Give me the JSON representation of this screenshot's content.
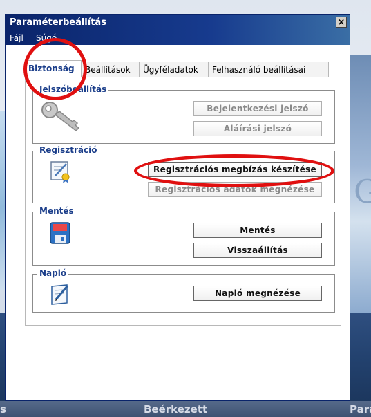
{
  "background": {
    "bottom_nav": {
      "left": "s",
      "middle": "Beérkezett",
      "right": "Para"
    }
  },
  "window": {
    "title": "Paraméterbeállítás",
    "close_glyph": "×",
    "menu": {
      "file": "Fájl",
      "help": "Súgó"
    },
    "tabs": [
      {
        "label": "Biztonság",
        "active": true
      },
      {
        "label": "Beállítások",
        "active": false
      },
      {
        "label": "Ügyféladatok",
        "active": false
      },
      {
        "label": "Felhasználó beállításai",
        "active": false
      }
    ],
    "groups": {
      "password": {
        "title": "Jelszóbeállítás",
        "icon": "key-icon",
        "buttons": {
          "login": "Bejelentkezési jelszó",
          "signing": "Aláírási jelszó"
        }
      },
      "registration": {
        "title": "Regisztráció",
        "icon": "certificate-icon",
        "buttons": {
          "create": "Regisztrációs megbízás készítése",
          "view": "Regisztrációs adatok megnézése"
        }
      },
      "save": {
        "title": "Mentés",
        "icon": "floppy-disk-icon",
        "buttons": {
          "save": "Mentés",
          "restore": "Visszaállítás"
        }
      },
      "log": {
        "title": "Napló",
        "icon": "notebook-pen-icon",
        "buttons": {
          "view": "Napló megnézése"
        }
      }
    }
  },
  "colors": {
    "titlebar": "#0a246a",
    "group_title": "#1b3e8a",
    "annotation": "#e01010"
  }
}
